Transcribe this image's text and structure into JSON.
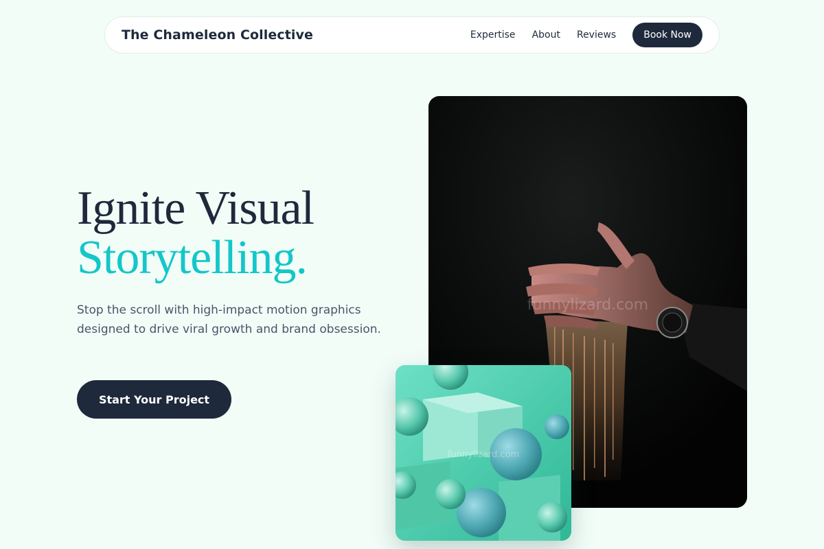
{
  "nav": {
    "brand": "The Chameleon Collective",
    "links": [
      {
        "label": "Expertise"
      },
      {
        "label": "About"
      },
      {
        "label": "Reviews"
      }
    ],
    "cta_label": "Book Now"
  },
  "hero": {
    "title_line1": "Ignite Visual",
    "title_line2": "Storytelling.",
    "subtitle": "Stop the scroll with high-impact motion graphics designed to drive viral growth and brand obsession.",
    "cta_label": "Start Your Project"
  },
  "images": {
    "main_watermark": "funnylizard.com",
    "small_watermark": "funnylizard.com"
  },
  "colors": {
    "background": "#f2fdf8",
    "primary_dark": "#1e293b",
    "accent_teal": "#14c6c8",
    "muted_text": "#475569"
  }
}
